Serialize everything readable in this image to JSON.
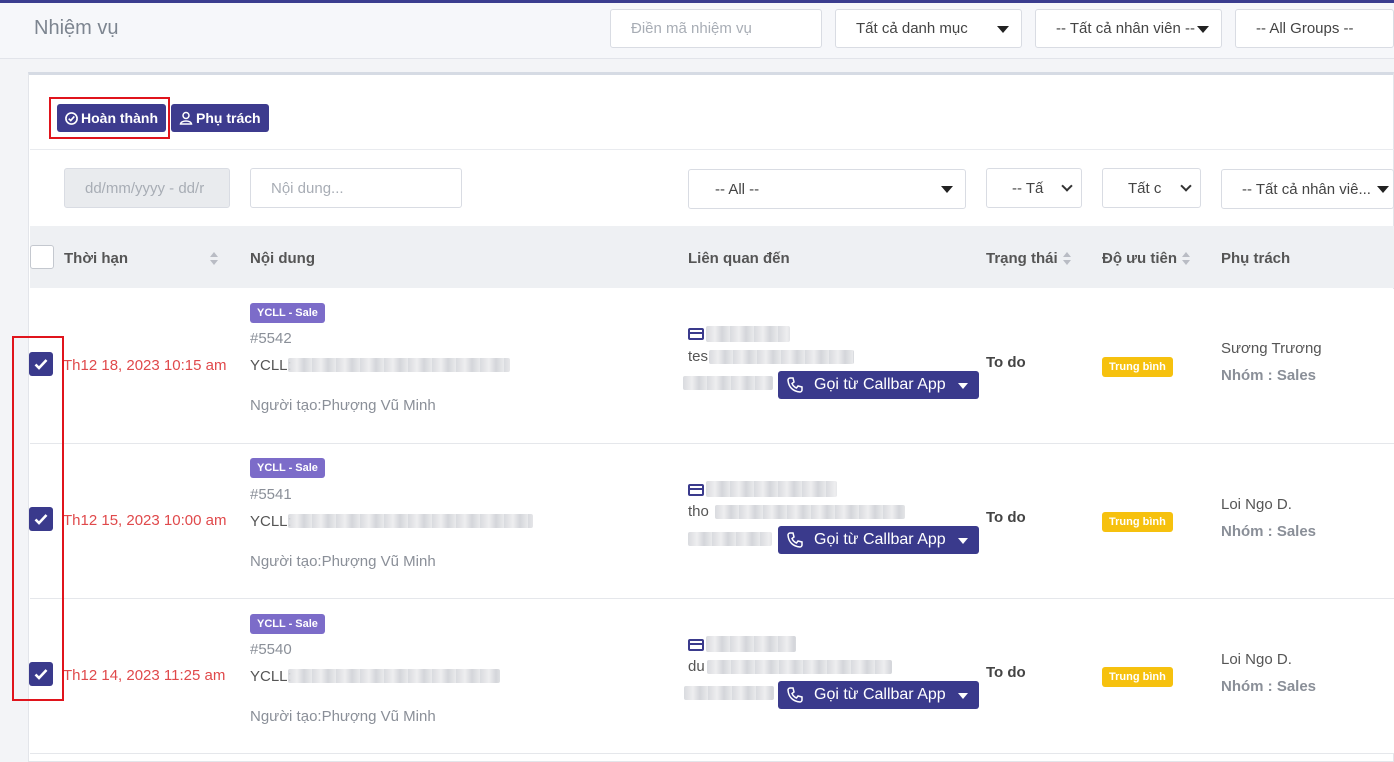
{
  "page_title": "Nhiệm vụ",
  "header_filters": {
    "task_code_placeholder": "Điền mã nhiệm vụ",
    "category": "Tất cả danh mục",
    "staff": "-- Tất cả nhân viên --",
    "groups": "-- All Groups --"
  },
  "actions": {
    "complete_label": "Hoàn thành",
    "assignee_label": "Phụ trách"
  },
  "table_filters": {
    "date_placeholder": "dd/mm/yyyy - dd/r",
    "content_placeholder": "Nội dung...",
    "related": "-- All --",
    "status": "-- Tấ",
    "priority": "Tất c",
    "staff": "-- Tất cả nhân viê..."
  },
  "columns": {
    "deadline": "Thời hạn",
    "content": "Nội dung",
    "related": "Liên quan đến",
    "status": "Trạng thái",
    "priority": "Độ ưu tiên",
    "assignee": "Phụ trách"
  },
  "rows": [
    {
      "checked": true,
      "deadline": "Th12 18, 2023 10:15 am",
      "tag": "YCLL - Sale",
      "id": "#5542",
      "content": "YCLL:",
      "creator": "Người tạo:Phượng Vũ Minh",
      "related_text": "tes",
      "call_label": "Gọi từ Callbar App",
      "status": "To do",
      "priority": "Trung bình",
      "assignee": "Sương Trương",
      "team": "Nhóm : Sales"
    },
    {
      "checked": true,
      "deadline": "Th12 15, 2023 10:00 am",
      "tag": "YCLL - Sale",
      "id": "#5541",
      "content": "YCLL:",
      "creator": "Người tạo:Phượng Vũ Minh",
      "related_text": "tho",
      "call_label": "Gọi từ Callbar App",
      "status": "To do",
      "priority": "Trung bình",
      "assignee": "Loi Ngo D.",
      "team": "Nhóm : Sales"
    },
    {
      "checked": true,
      "deadline": "Th12 14, 2023 11:25 am",
      "tag": "YCLL - Sale",
      "id": "#5540",
      "content": "YCLL:",
      "creator": "Người tạo:Phượng Vũ Minh",
      "related_text": "du",
      "call_label": "Gọi từ Callbar App",
      "status": "To do",
      "priority": "Trung bình",
      "assignee": "Loi Ngo D.",
      "team": "Nhóm : Sales"
    }
  ],
  "colors": {
    "primary": "#3a3a8c",
    "deadline_red": "#e0494b",
    "tag_purple": "#7c6cc9",
    "priority_yellow": "#f6c10e",
    "highlight_red": "#e0141c"
  }
}
